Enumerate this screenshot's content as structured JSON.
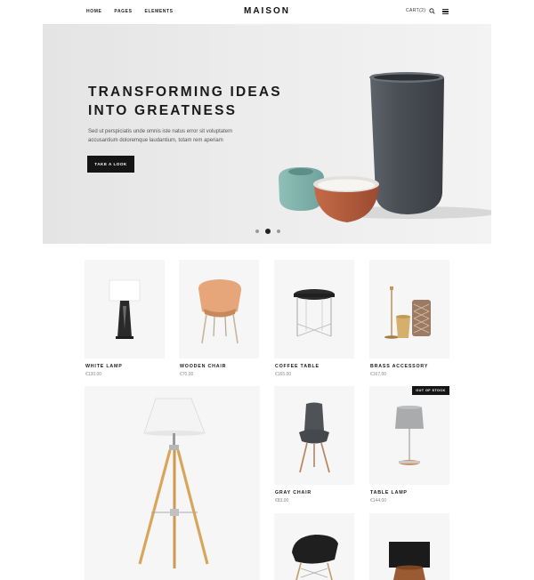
{
  "header": {
    "nav": [
      "HOME",
      "PAGES",
      "ELEMENTS"
    ],
    "logo": "MAISON",
    "cart": "CART(2)"
  },
  "hero": {
    "title_line1": "TRANSFORMING IDEAS",
    "title_line2": "INTO GREATNESS",
    "text": "Sed ut perspiciatis unde omnis iste natus error sit voluptatem accusantium doloremque laudantium, totam rem aperiam",
    "button": "TAKE A LOOK",
    "slides_total": 3,
    "active_slide": 2
  },
  "products": [
    {
      "name": "WHITE LAMP",
      "price": "€130.00"
    },
    {
      "name": "WOODEN CHAIR",
      "price": "€70.00"
    },
    {
      "name": "COFFEE TABLE",
      "price": "€165.00"
    },
    {
      "name": "BRASS ACCESSORY",
      "price": "€167.00"
    },
    {
      "name": "GRAY CHAIR",
      "price": "€83.00"
    },
    {
      "name": "TABLE LAMP",
      "price": "€144.00",
      "badge": "OUT OF STOCK"
    }
  ],
  "colors": {
    "accent": "#151515",
    "hero_bg": "#ebebeb",
    "card_bg": "#f6f6f6",
    "price": "#8a8a8a"
  },
  "icons": [
    "search-icon",
    "menu-icon"
  ]
}
